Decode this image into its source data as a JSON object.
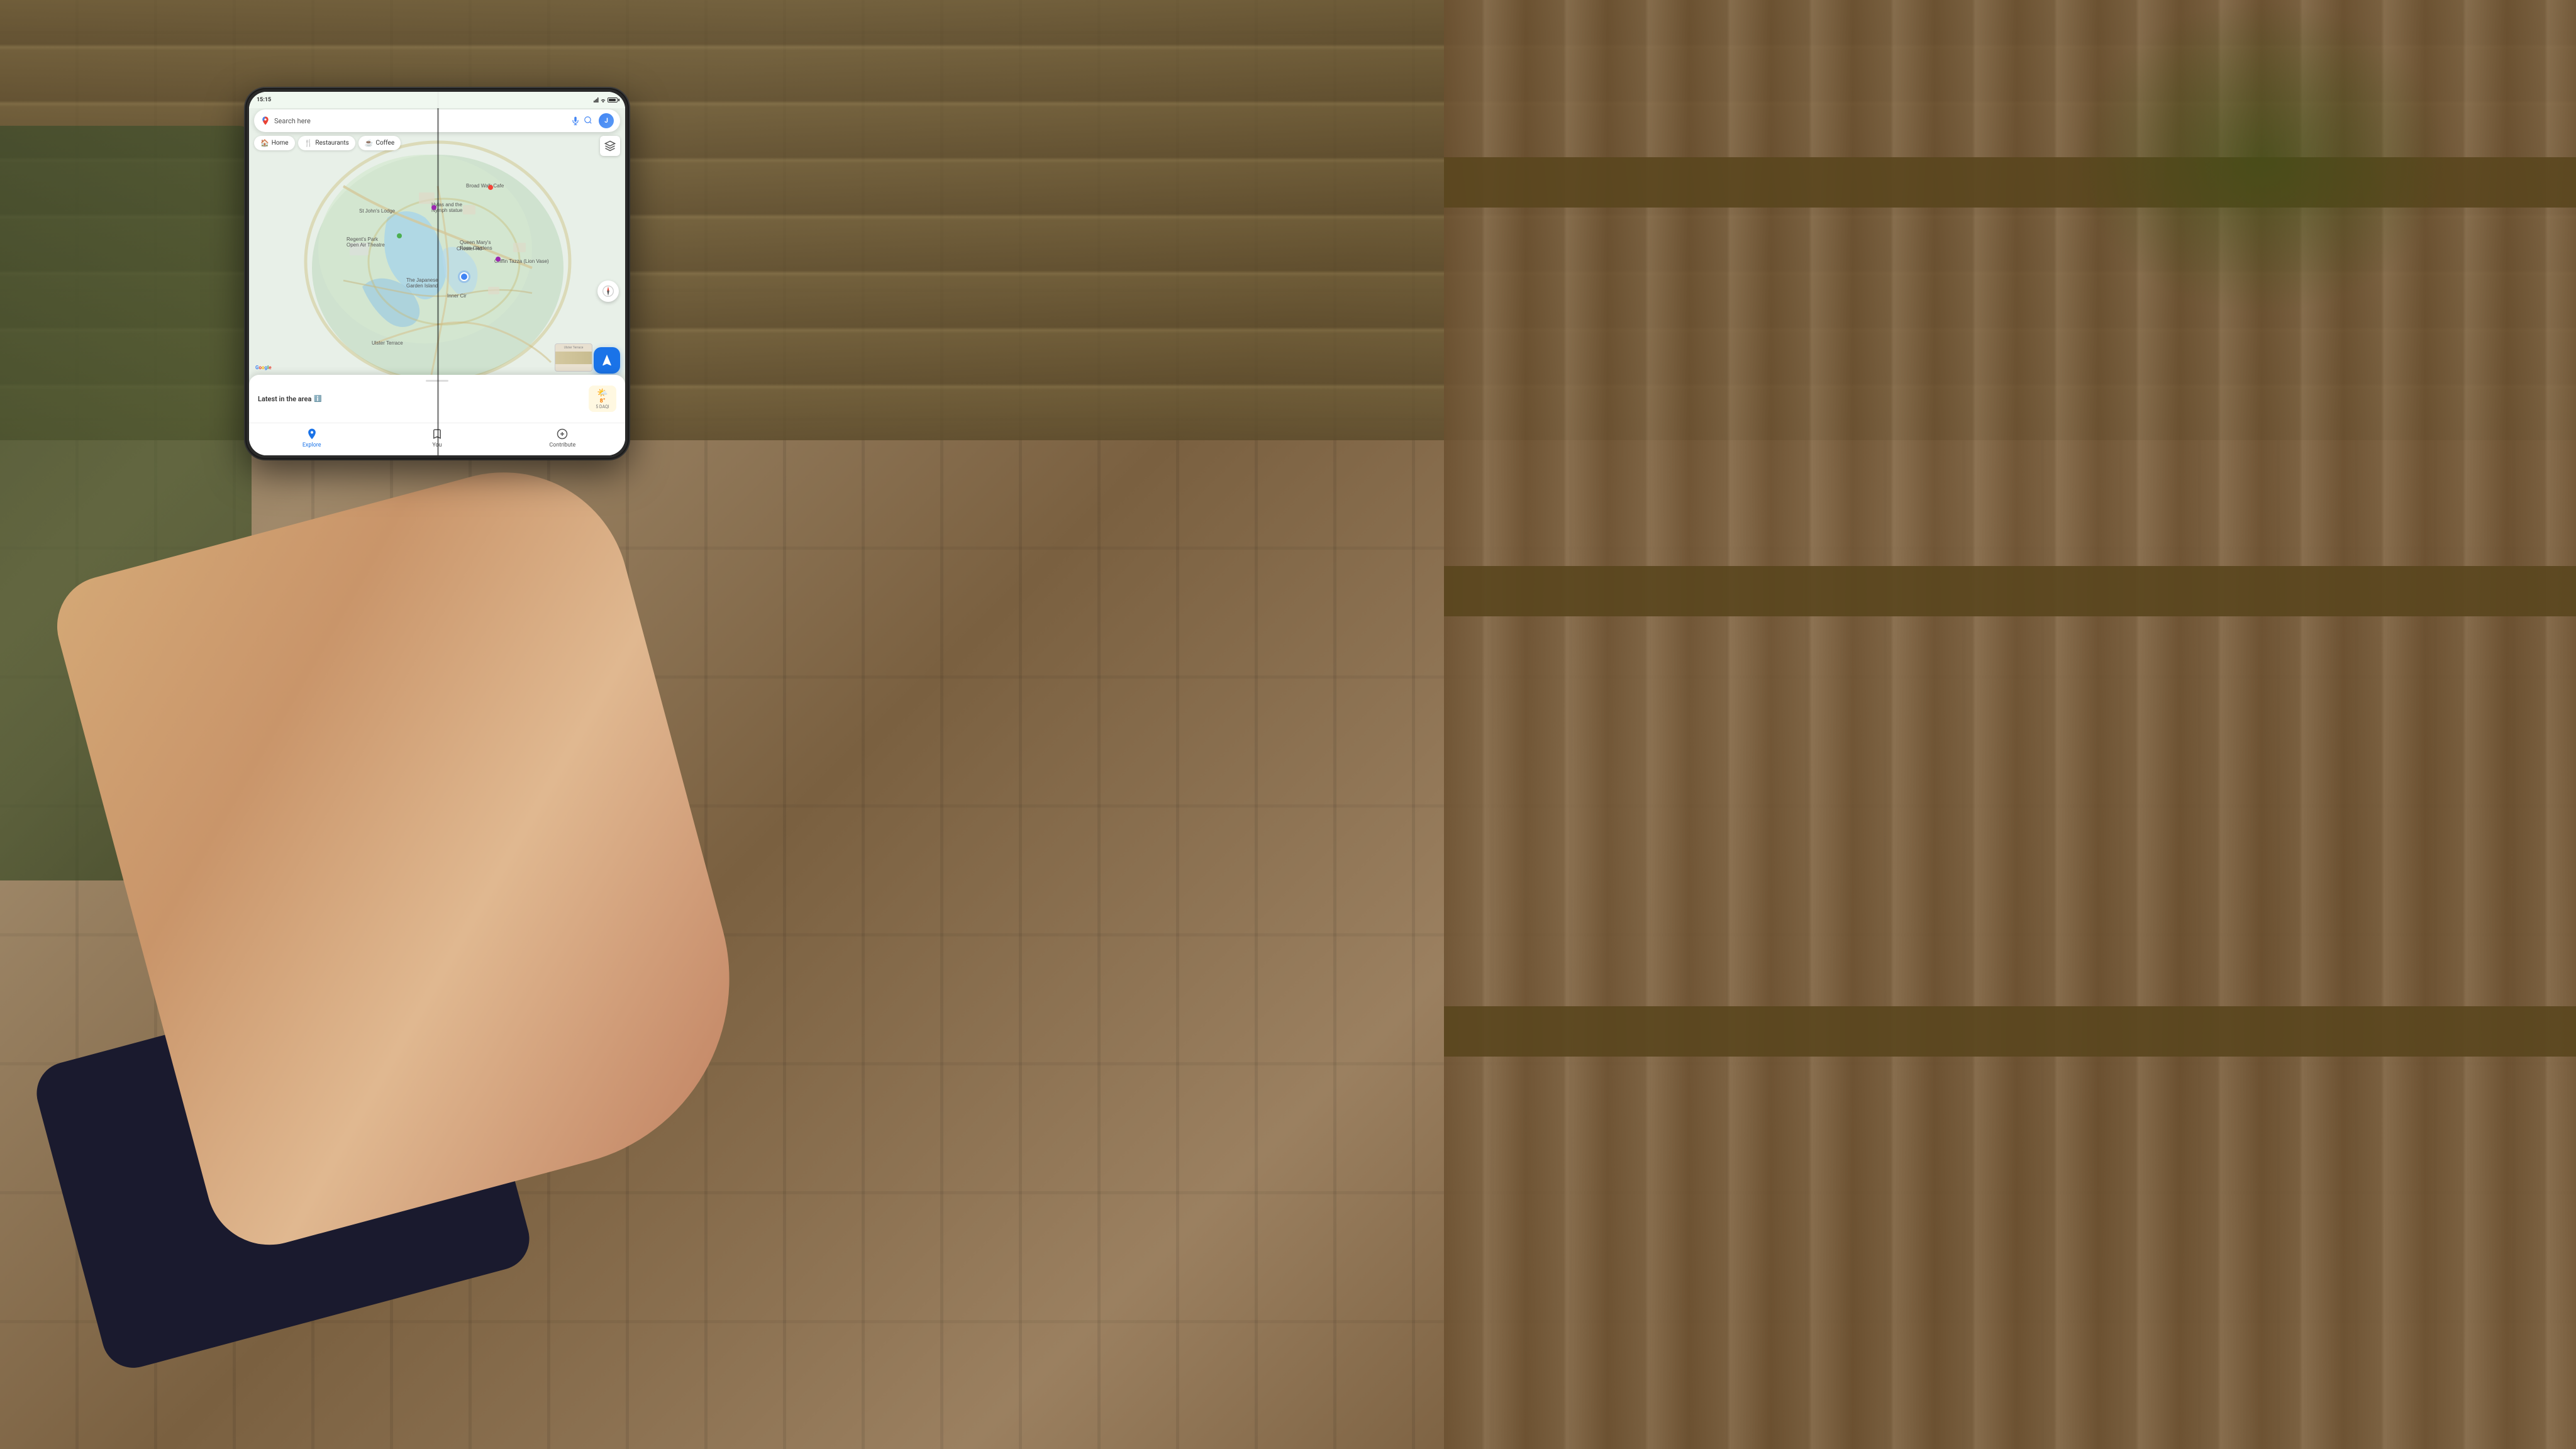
{
  "background": {
    "description": "Wooden deck background with fence and moss/stone"
  },
  "phone": {
    "status_bar": {
      "time": "15:15",
      "battery_percent": 80
    },
    "search_bar": {
      "placeholder": "Search here",
      "avatar_letter": "J"
    },
    "top_dots": "...",
    "quick_nav": {
      "items": [
        {
          "label": "Home",
          "icon": "🏠"
        },
        {
          "label": "Restaurants",
          "icon": "🍴"
        },
        {
          "label": "Coffee",
          "icon": "☕"
        }
      ]
    },
    "map": {
      "location_marker": "current location",
      "labels": [
        "St John's Lodge",
        "Hylas and the Nymph statue",
        "Regent's Park Open Air Theatre",
        "Queen Mary's Rose Gardens",
        "Griffin Tazza (Lion Vase)",
        "The Japanese Garden Island",
        "Chester Rd",
        "Inner Cir",
        "Ulster Terrace",
        "Broad Walk Cafe"
      ]
    },
    "weather_badge": {
      "icon": "🌤️",
      "temperature": "8",
      "aqi_label": "5 DAQI"
    },
    "latest_area": {
      "title": "Latest in the area",
      "info_icon": "ⓘ"
    },
    "bottom_nav": [
      {
        "label": "Explore",
        "icon": "📍",
        "active": true
      },
      {
        "label": "You",
        "icon": "🔖",
        "active": false
      },
      {
        "label": "Contribute",
        "icon": "➕",
        "active": false
      }
    ],
    "google_logo": "Google",
    "layers_icon": "⊞",
    "compass_icon": "◎",
    "nav_fab_icon": "➤"
  }
}
